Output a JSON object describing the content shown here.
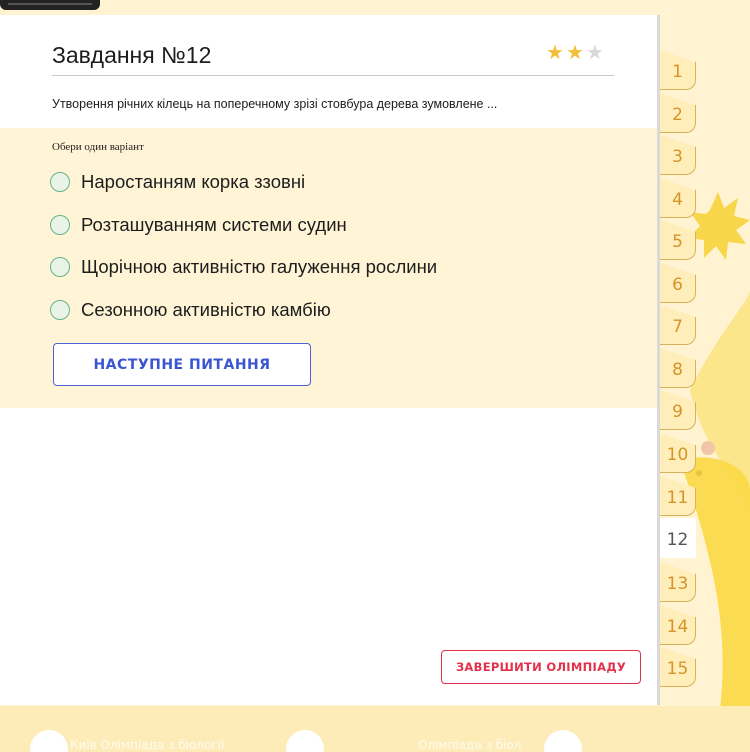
{
  "task": {
    "title": "Завдання №12",
    "rating": {
      "filled": 2,
      "total": 3
    },
    "question": "Утворення річних кілець на поперечному зрізі стовбура дерева зумовлене ...",
    "hint": "Обери один варіант",
    "options": [
      "Наростанням корка ззовні",
      "Розташуванням системи судин",
      "Щорічною активністю галуження рослини",
      "Сезонною активністю камбію"
    ],
    "next_button": "НАСТУПНЕ ПИТАННЯ",
    "finish_button": "ЗАВЕРШИТИ ОЛІМПІАДУ"
  },
  "tabs": {
    "items": [
      "1",
      "2",
      "3",
      "4",
      "5",
      "6",
      "7",
      "8",
      "9",
      "10",
      "11",
      "12",
      "13",
      "14",
      "15"
    ],
    "active": "12"
  },
  "footer": {
    "left_text": "Київ Олімпіада з біології",
    "right_text": "Олімпіада з біол"
  },
  "colors": {
    "page_bg": "#fff3d1",
    "accent_blue": "#3b55d1",
    "accent_red": "#e2314a",
    "star_on": "#f2bf3a",
    "tab_text": "#d49429"
  }
}
